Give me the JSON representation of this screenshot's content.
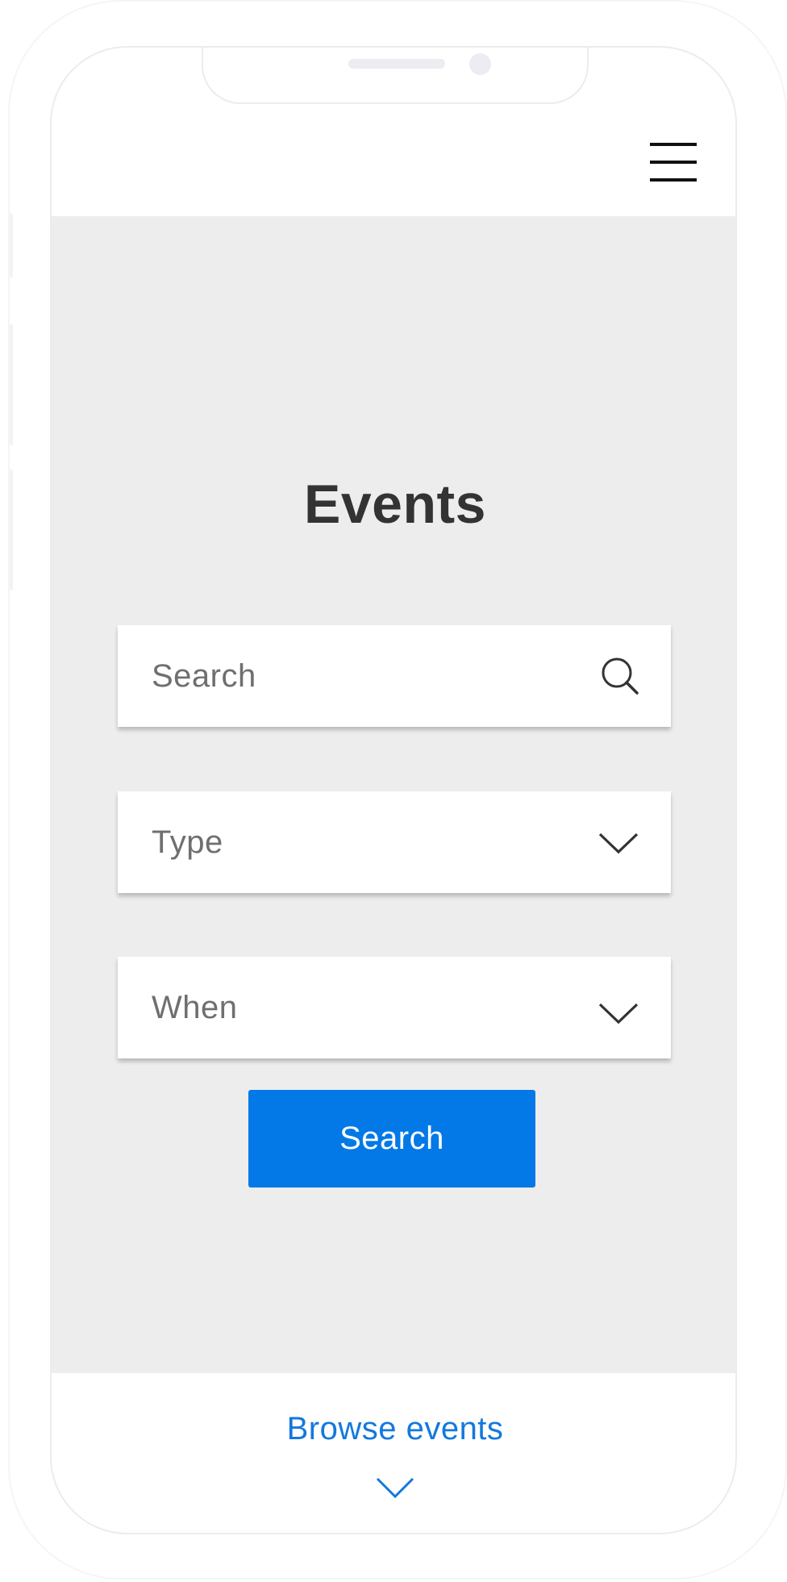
{
  "header": {
    "menu_icon": "hamburger-menu-icon"
  },
  "hero": {
    "title": "Events",
    "search": {
      "placeholder": "Search",
      "icon": "search-icon"
    },
    "type_select": {
      "label": "Type",
      "icon": "chevron-down-icon"
    },
    "when_select": {
      "label": "When",
      "icon": "chevron-down-icon"
    },
    "search_button": {
      "label": "Search",
      "color": "#0279e6"
    },
    "background": "#ededed"
  },
  "footer": {
    "browse_label": "Browse events",
    "browse_icon": "chevron-down-icon",
    "accent": "#1478dd"
  }
}
